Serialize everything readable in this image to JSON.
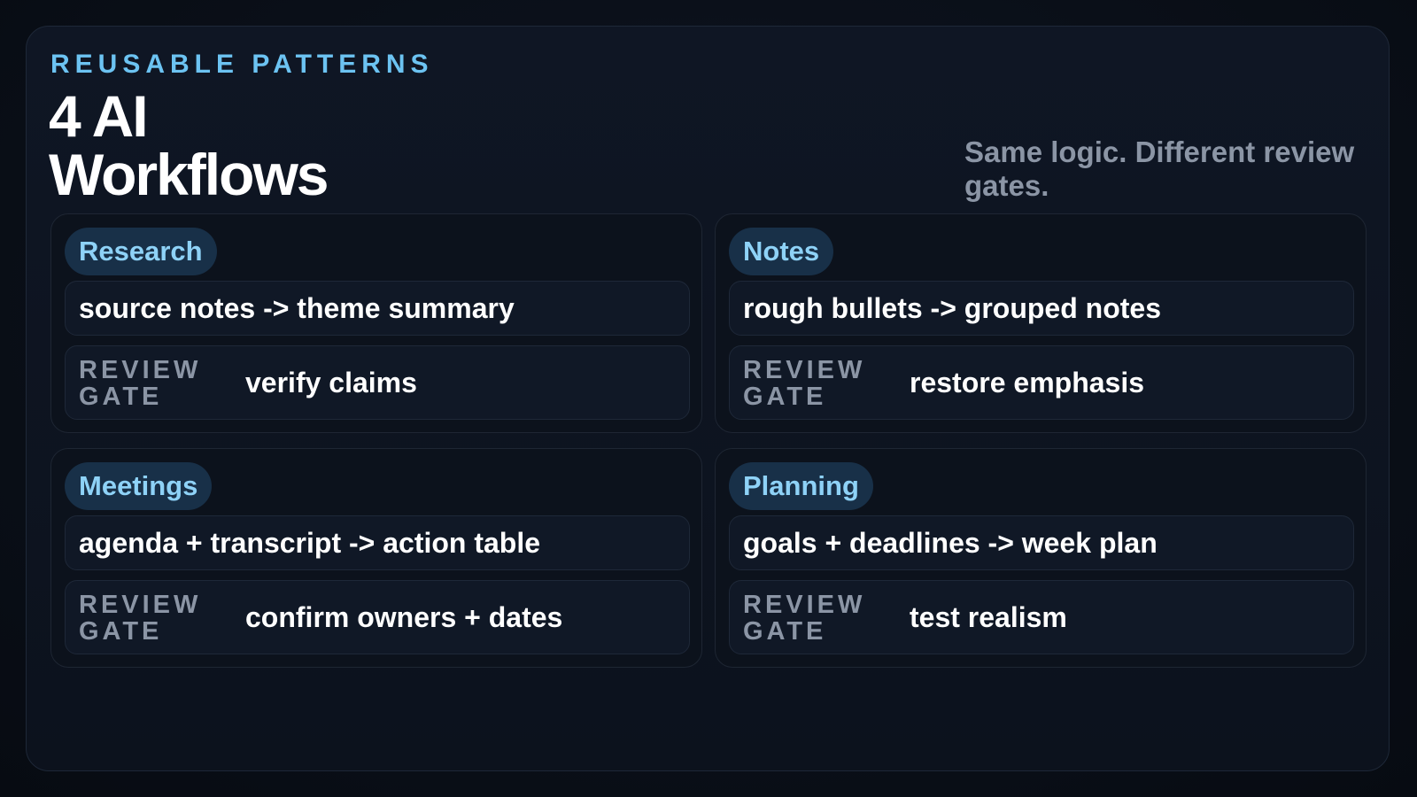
{
  "header": {
    "eyebrow": "REUSABLE PATTERNS",
    "title": "4 AI Workflows",
    "subtitle": "Same logic. Different review gates."
  },
  "gate_label": "REVIEW GATE",
  "workflows": [
    {
      "name": "Research",
      "flow": "source notes -> theme summary",
      "gate": "verify claims"
    },
    {
      "name": "Notes",
      "flow": "rough bullets -> grouped notes",
      "gate": "restore emphasis"
    },
    {
      "name": "Meetings",
      "flow": "agenda + transcript -> action table",
      "gate": "confirm owners + dates"
    },
    {
      "name": "Planning",
      "flow": "goals + deadlines -> week plan",
      "gate": "test realism"
    }
  ],
  "colors": {
    "accent": "#6cc3f2",
    "chip_background": "#183048",
    "muted_text": "#8b95a5"
  }
}
